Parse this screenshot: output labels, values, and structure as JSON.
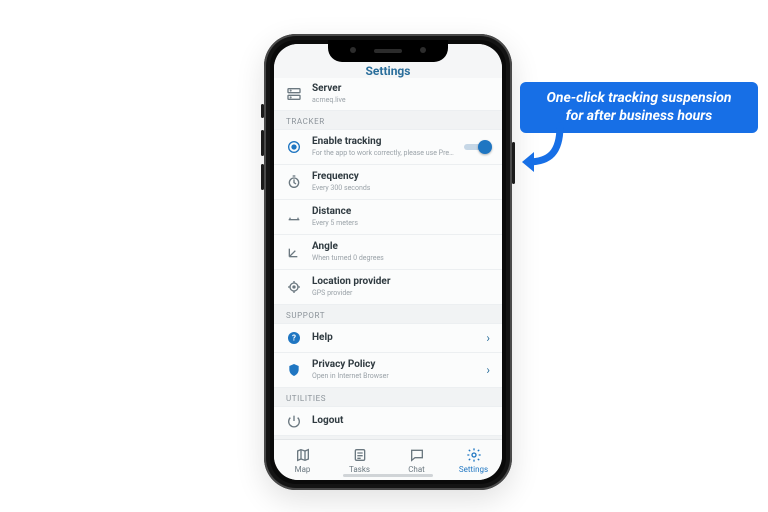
{
  "header": {
    "title": "Settings"
  },
  "server_row": {
    "label": "Server",
    "sub": "acmeq.live"
  },
  "sections": {
    "tracker": "TRACKER",
    "support": "SUPPORT",
    "utilities": "UTILITIES"
  },
  "tracker": {
    "enable": {
      "label": "Enable tracking",
      "sub": "For the app to work correctly, please use Precise permission"
    },
    "frequency": {
      "label": "Frequency",
      "sub": "Every 300 seconds"
    },
    "distance": {
      "label": "Distance",
      "sub": "Every 5 meters"
    },
    "angle": {
      "label": "Angle",
      "sub": "When turned 0 degrees"
    },
    "provider": {
      "label": "Location provider",
      "sub": "GPS provider"
    }
  },
  "support": {
    "help": {
      "label": "Help"
    },
    "privacy": {
      "label": "Privacy Policy",
      "sub": "Open in Internet Browser"
    }
  },
  "utilities": {
    "logout": {
      "label": "Logout"
    }
  },
  "tabs": {
    "map": "Map",
    "tasks": "Tasks",
    "chat": "Chat",
    "settings": "Settings"
  },
  "callout": {
    "line1": "One-click tracking suspension",
    "line2": "for after business hours"
  },
  "chevron": "›",
  "colors": {
    "accent": "#1f76c2",
    "callout": "#176fe6"
  }
}
